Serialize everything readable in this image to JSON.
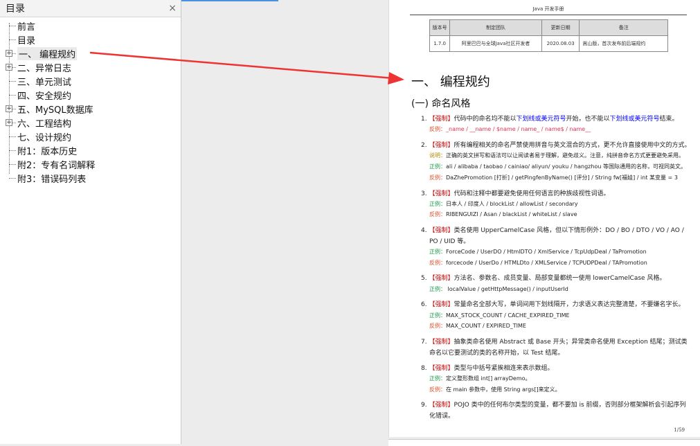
{
  "toc": {
    "title": "目录",
    "close": "×",
    "items": [
      {
        "label": "前言",
        "expandable": false
      },
      {
        "label": "目录",
        "expandable": false
      },
      {
        "label": "一、 编程规约",
        "expandable": true,
        "selected": true
      },
      {
        "label": "二、异常日志",
        "expandable": true
      },
      {
        "label": "三、单元测试",
        "expandable": false
      },
      {
        "label": "四、安全规约",
        "expandable": false
      },
      {
        "label": "五、MySQL数据库",
        "expandable": true
      },
      {
        "label": "六、工程结构",
        "expandable": true
      },
      {
        "label": "七、设计规约",
        "expandable": false
      },
      {
        "label": "附1：版本历史",
        "expandable": false
      },
      {
        "label": "附2：专有名词解释",
        "expandable": false
      },
      {
        "label": "附3：错误码列表",
        "expandable": false
      }
    ]
  },
  "doc": {
    "header": "Java 开发手册",
    "table": {
      "headers": [
        "版本号",
        "制定团队",
        "更新日期",
        "备注"
      ],
      "row": [
        "1.7.0",
        "阿里巴巴与全球Java社区开发者",
        "2020.08.03",
        "嵩山版，首次发布前后端规约"
      ]
    },
    "h1": "一、 编程规约",
    "h2": "(一) 命名风格",
    "force": "【强制】",
    "lines": [
      {
        "n": "1.",
        "a": "代码中的命名均不能以",
        "b1": "下划线或美元符号",
        "c": "开始，也不能以",
        "b2": "下划线或美元符号",
        "d": "结束。"
      },
      {
        "label": "反例：",
        "text": "_name / __name / $name / name_ / name$ / name__"
      },
      {
        "n": "2.",
        "a": "所有编程相关的命名严禁使用拼音与英文混合的方式，更不允许直接使用中文的方式。"
      },
      {
        "label": "说明：",
        "text": "正确的英文拼写和语法可以让阅读者易于理解，避免歧义。注意，纯拼音命名方式更要避免采用。"
      },
      {
        "label": "正例：",
        "text": "ali / alibaba / taobao / cainiao/ aliyun/ youku / hangzhou  等国际通用的名称，可视同英文。"
      },
      {
        "label": "反例：",
        "text": "DaZhePromotion [打折] / getPingfenByName() [评分] / String fw[福娃] / int  某变量  = 3"
      },
      {
        "n": "3.",
        "a": "代码和注释中都要避免使用任何语言的种族歧视性词语。"
      },
      {
        "label": "正例：",
        "text": "日本人  /  印度人  / blockList / allowList / secondary"
      },
      {
        "label": "反例：",
        "text": "RIBENGUIZI / Asan / blackList / whiteList / slave"
      },
      {
        "n": "4.",
        "a": "类名使用 UpperCamelCase 风格，但以下情形例外：DO / BO / DTO / VO / AO /"
      },
      {
        "cont": "PO / UID 等。"
      },
      {
        "label": "正例：",
        "text": "ForceCode   /   UserDO   /   HtmlDTO   /   XmlService   /   TcpUdpDeal   /   TaPromotion"
      },
      {
        "label": "反例：",
        "text": "forcecode   /   UserDo   /   HTMLDto   /   XMLService   /   TCPUDPDeal   /   TAPromotion"
      },
      {
        "n": "5.",
        "a": "方法名、参数名、成员变量、局部变量都统一使用 lowerCamelCase 风格。"
      },
      {
        "label": "正例：",
        "text": " localValue / getHttpMessage() / inputUserId"
      },
      {
        "n": "6.",
        "a": "常量命名全部大写，单词间用下划线隔开，力求语义表达完整清楚，不要嫌名字长。"
      },
      {
        "label": "正例：",
        "text": "MAX_STOCK_COUNT / CACHE_EXPIRED_TIME"
      },
      {
        "label": "反例：",
        "text": "MAX_COUNT / EXPIRED_TIME"
      },
      {
        "n": "7.",
        "a": "抽象类命名使用 Abstract 或 Base 开头；异常类命名使用 Exception 结尾；测试类"
      },
      {
        "cont": "命名以它要测试的类的名称开始，以 Test 结尾。"
      },
      {
        "n": "8.",
        "a": "类型与中括号紧挨相连来表示数组。"
      },
      {
        "label": "正例：",
        "text": "定义整形数组 int[] arrayDemo。"
      },
      {
        "label": "反例：",
        "text": "在 main 参数中，使用 String args[]来定义。"
      },
      {
        "n": "9.",
        "a": "POJO 类中的任何布尔类型的变量，都不要加 is 前缀，否则部分框架解析会引起序列"
      },
      {
        "cont": "化错误。"
      }
    ],
    "page_number": "1/59"
  },
  "colors": {
    "force": "#cc0000",
    "arrow": "#ee3333"
  }
}
